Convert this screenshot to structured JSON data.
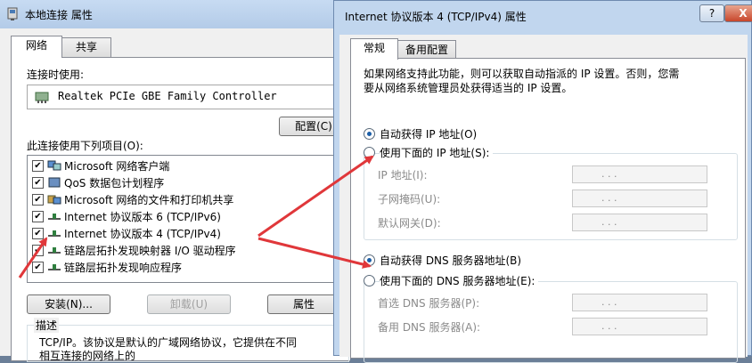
{
  "left_dialog": {
    "title": "本地连接 属性",
    "tabs": [
      {
        "label": "网络"
      },
      {
        "label": "共享"
      }
    ],
    "connect_using_label": "连接时使用:",
    "adapter": "Realtek PCIe GBE Family Controller",
    "configure_button": "配置(C)",
    "items_label": "此连接使用下列项目(O):",
    "items": [
      {
        "label": "Microsoft 网络客户端",
        "checked": true,
        "icon": "network-client-icon"
      },
      {
        "label": "QoS 数据包计划程序",
        "checked": true,
        "icon": "qos-icon"
      },
      {
        "label": "Microsoft 网络的文件和打印机共享",
        "checked": true,
        "icon": "file-printer-sharing-icon"
      },
      {
        "label": "Internet 协议版本 6 (TCP/IPv6)",
        "checked": true,
        "icon": "protocol-icon"
      },
      {
        "label": "Internet 协议版本 4 (TCP/IPv4)",
        "checked": true,
        "icon": "protocol-icon"
      },
      {
        "label": "链路层拓扑发现映射器 I/O 驱动程序",
        "checked": true,
        "icon": "protocol-icon"
      },
      {
        "label": "链路层拓扑发现响应程序",
        "checked": true,
        "icon": "protocol-icon"
      }
    ],
    "install_button": "安装(N)...",
    "uninstall_button": "卸载(U)",
    "properties_button": "属性",
    "description_label": "描述",
    "description_text": "TCP/IP。该协议是默认的广域网络协议，它提供在不同",
    "description_text2": "相互连接的网络上的"
  },
  "right_dialog": {
    "title": "Internet 协议版本 4 (TCP/IPv4) 属性",
    "help_button": "?",
    "close_button": "X",
    "tabs": [
      {
        "label": "常规"
      },
      {
        "label": "备用配置"
      }
    ],
    "intro_line1": "如果网络支持此功能，则可以获取自动指派的 IP 设置。否则，您需",
    "intro_line2": "要从网络系统管理员处获得适当的 IP 设置。",
    "ip_auto": "自动获得 IP 地址(O)",
    "ip_manual": "使用下面的 IP 地址(S):",
    "ip_address_label": "IP 地址(I):",
    "subnet_label": "子网掩码(U):",
    "gateway_label": "默认网关(D):",
    "dns_auto": "自动获得 DNS 服务器地址(B)",
    "dns_manual": "使用下面的 DNS 服务器地址(E):",
    "preferred_dns_label": "首选 DNS 服务器(P):",
    "alternate_dns_label": "备用 DNS 服务器(A):",
    "ip_dots": ".    .    ."
  },
  "colors": {
    "arrow": "#e0373a",
    "title_bar": "#c1d6ee",
    "radio_dot": "#1c5fa8"
  }
}
